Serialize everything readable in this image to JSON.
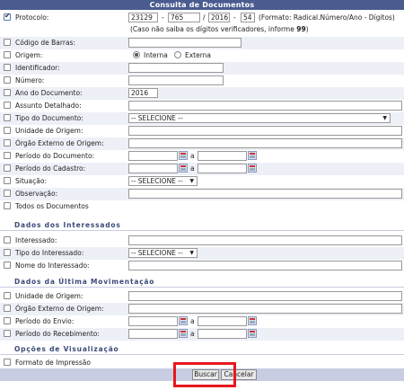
{
  "title": "Consulta de Documentos",
  "protocolo": {
    "label": "Protocolo:",
    "radical": "23129",
    "numero": "765",
    "ano": "2016",
    "digitos": "54",
    "sep1": "-",
    "sep2": "/",
    "sep3": "-",
    "format_hint": "(Formato: Radical.Número/Ano - Dígitos)",
    "help_prefix": "(Caso não saiba os dígitos verificadores, informe ",
    "help_value": "99",
    "help_suffix": ")"
  },
  "fields": {
    "codigo_barras": "Código de Barras:",
    "origem": "Origem:",
    "origem_interna": "Interna",
    "origem_externa": "Externa",
    "identificador": "Identificador:",
    "numero": "Número:",
    "ano_documento": "Ano do Documento:",
    "ano_documento_value": "2016",
    "assunto": "Assunto Detalhado:",
    "tipo_documento": "Tipo do Documento:",
    "tipo_documento_value": "-- SELECIONE --",
    "unidade_origem": "Unidade de Origem:",
    "orgao_externo": "Órgão Externo de Origem:",
    "periodo_documento": "Período do Documento:",
    "periodo_cadastro": "Período do Cadastro:",
    "situacao": "Situação:",
    "situacao_value": "-- SELECIONE --",
    "observacao": "Observação:",
    "todos_documentos": "Todos os Documentos",
    "a": "a"
  },
  "interessados": {
    "header": "Dados dos Interessados",
    "interessado": "Interessado:",
    "tipo_interessado": "Tipo do Interessado:",
    "tipo_interessado_value": "-- SELECIONE --",
    "nome_interessado": "Nome do Interessado:"
  },
  "movimentacao": {
    "header": "Dados da Última Movimentação",
    "unidade_origem": "Unidade de Origem:",
    "orgao_externo": "Órgão Externo de Origem:",
    "periodo_envio": "Período do Envio:",
    "periodo_recebimento": "Período do Recebimento:",
    "a": "a"
  },
  "visualizacao": {
    "header": "Opções de Visualização",
    "formato_impressao": "Formato de Impressão"
  },
  "buttons": {
    "buscar": "Buscar",
    "cancelar": "Cancelar"
  },
  "colors": {
    "title_bar": "#4a5b8f",
    "highlight": "#e8171d"
  }
}
